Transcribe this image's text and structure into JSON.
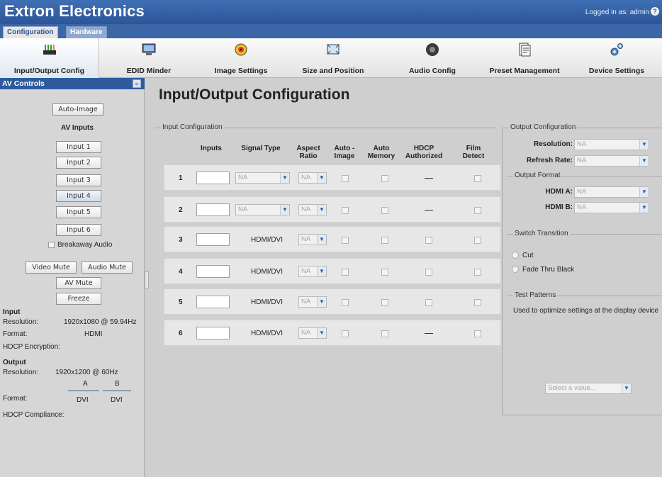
{
  "header": {
    "brand": "Extron Electronics",
    "login": "Logged in as: admin",
    "help": "?"
  },
  "tabs": [
    {
      "label": "Configuration"
    },
    {
      "label": "Hardware"
    }
  ],
  "toolbar": [
    {
      "label": "Input/Output Config",
      "icon": "input-output-icon"
    },
    {
      "label": "EDID Minder",
      "icon": "monitor-icon"
    },
    {
      "label": "Image Settings",
      "icon": "image-settings-icon"
    },
    {
      "label": "Size and Position",
      "icon": "size-position-icon"
    },
    {
      "label": "Audio Config",
      "icon": "speaker-icon"
    },
    {
      "label": "Preset Management",
      "icon": "preset-icon"
    },
    {
      "label": "Device Settings",
      "icon": "gears-icon"
    }
  ],
  "sidebar": {
    "title": "AV Controls",
    "collapse": "«",
    "auto_image": "Auto-Image",
    "av_inputs": "AV Inputs",
    "inputs": [
      "Input 1",
      "Input 2",
      "Input 3",
      "Input 4",
      "Input 5",
      "Input 6"
    ],
    "breakaway": "Breakaway Audio",
    "video_mute": "Video Mute",
    "audio_mute": "Audio Mute",
    "av_mute": "AV Mute",
    "freeze": "Freeze",
    "input_heading": "Input",
    "input_res_label": "Resolution:",
    "input_res_value": "1920x1080 @ 59.94Hz",
    "input_format_label": "Format:",
    "input_format_value": "HDMI",
    "hdcp_enc_label": "HDCP Encryption:",
    "output_heading": "Output",
    "output_res_label": "Resolution:",
    "output_res_value": "1920x1200 @ 60Hz",
    "col_a": "A",
    "col_b": "B",
    "output_format_label": "Format:",
    "output_format_a": "DVI",
    "output_format_b": "DVI",
    "hdcp_comp_label": "HDCP Compliance:"
  },
  "main": {
    "title": "Input/Output Configuration",
    "input_config": "Input Configuration",
    "headers": {
      "inputs": "Inputs",
      "signal_type": "Signal Type",
      "aspect_ratio": "Aspect Ratio",
      "auto_image": "Auto - Image",
      "auto_memory": "Auto Memory",
      "hdcp_authorized": "HDCP Authorized",
      "film_detect": "Film Detect"
    },
    "rows": [
      {
        "num": "1",
        "signal": "NA",
        "signal_is_dropdown": true,
        "aspect": "NA",
        "hdcp": "dash"
      },
      {
        "num": "2",
        "signal": "NA",
        "signal_is_dropdown": true,
        "aspect": "NA",
        "hdcp": "dash"
      },
      {
        "num": "3",
        "signal": "HDMI/DVI",
        "signal_is_dropdown": false,
        "aspect": "NA",
        "hdcp": "box"
      },
      {
        "num": "4",
        "signal": "HDMI/DVI",
        "signal_is_dropdown": false,
        "aspect": "NA",
        "hdcp": "box"
      },
      {
        "num": "5",
        "signal": "HDMI/DVI",
        "signal_is_dropdown": false,
        "aspect": "NA",
        "hdcp": "box"
      },
      {
        "num": "6",
        "signal": "HDMI/DVI",
        "signal_is_dropdown": false,
        "aspect": "NA",
        "hdcp": "dash"
      }
    ],
    "output_config": "Output Configuration",
    "resolution_label": "Resolution:",
    "resolution_value": "NA",
    "refresh_label": "Refresh Rate:",
    "refresh_value": "NA",
    "output_format": "Output Format",
    "hdmi_a_label": "HDMI A:",
    "hdmi_a_value": "NA",
    "hdmi_b_label": "HDMI B:",
    "hdmi_b_value": "NA",
    "switch_transition": "Switch Transition",
    "cut": "Cut",
    "fade": "Fade Thru Black",
    "test_patterns": "Test Patterns",
    "test_desc": "Used to optimize settings at the display device",
    "select_placeholder": "Select a value..."
  }
}
